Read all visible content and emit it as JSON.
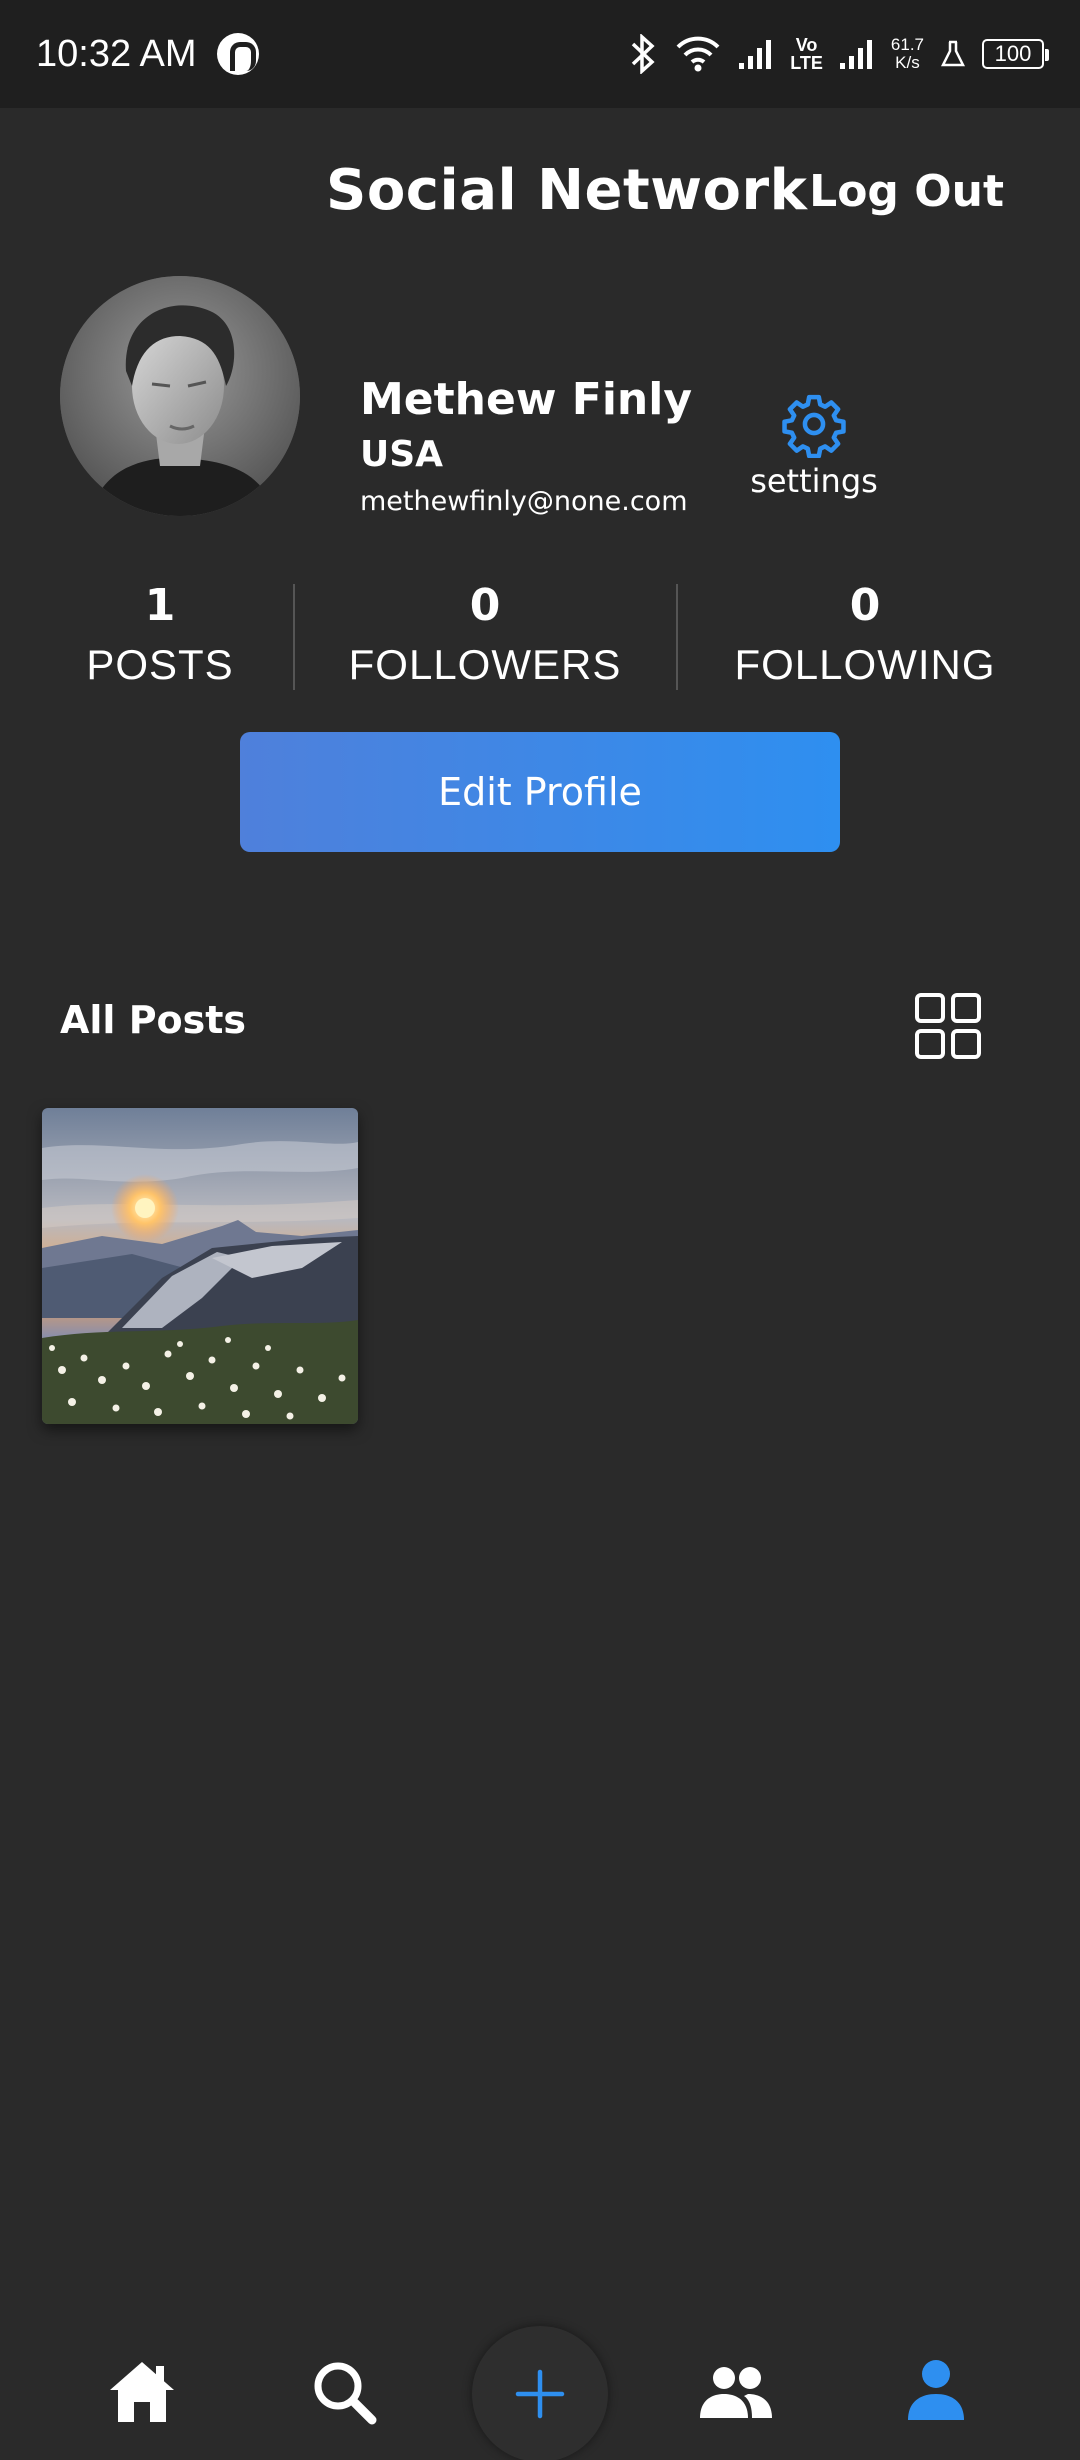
{
  "status_bar": {
    "time": "10:32 AM",
    "volte_top": "Vo",
    "volte_bottom": "LTE",
    "net_speed_top": "61.7",
    "net_speed_bottom": "K/s",
    "battery": "100"
  },
  "header": {
    "title": "Social Network",
    "logout_label": "Log Out"
  },
  "profile": {
    "name": "Methew Finly",
    "country": "USA",
    "email": "methewfinly@none.com",
    "settings_label": "settings"
  },
  "stats": {
    "posts": {
      "value": "1",
      "label": "POSTS"
    },
    "followers": {
      "value": "0",
      "label": "FOLLOWERS"
    },
    "following": {
      "value": "0",
      "label": "FOLLOWING"
    }
  },
  "edit_profile_label": "Edit Profile",
  "posts_section": {
    "title": "All Posts"
  },
  "colors": {
    "background": "#2a2a2a",
    "accent": "#2e8ff0"
  }
}
